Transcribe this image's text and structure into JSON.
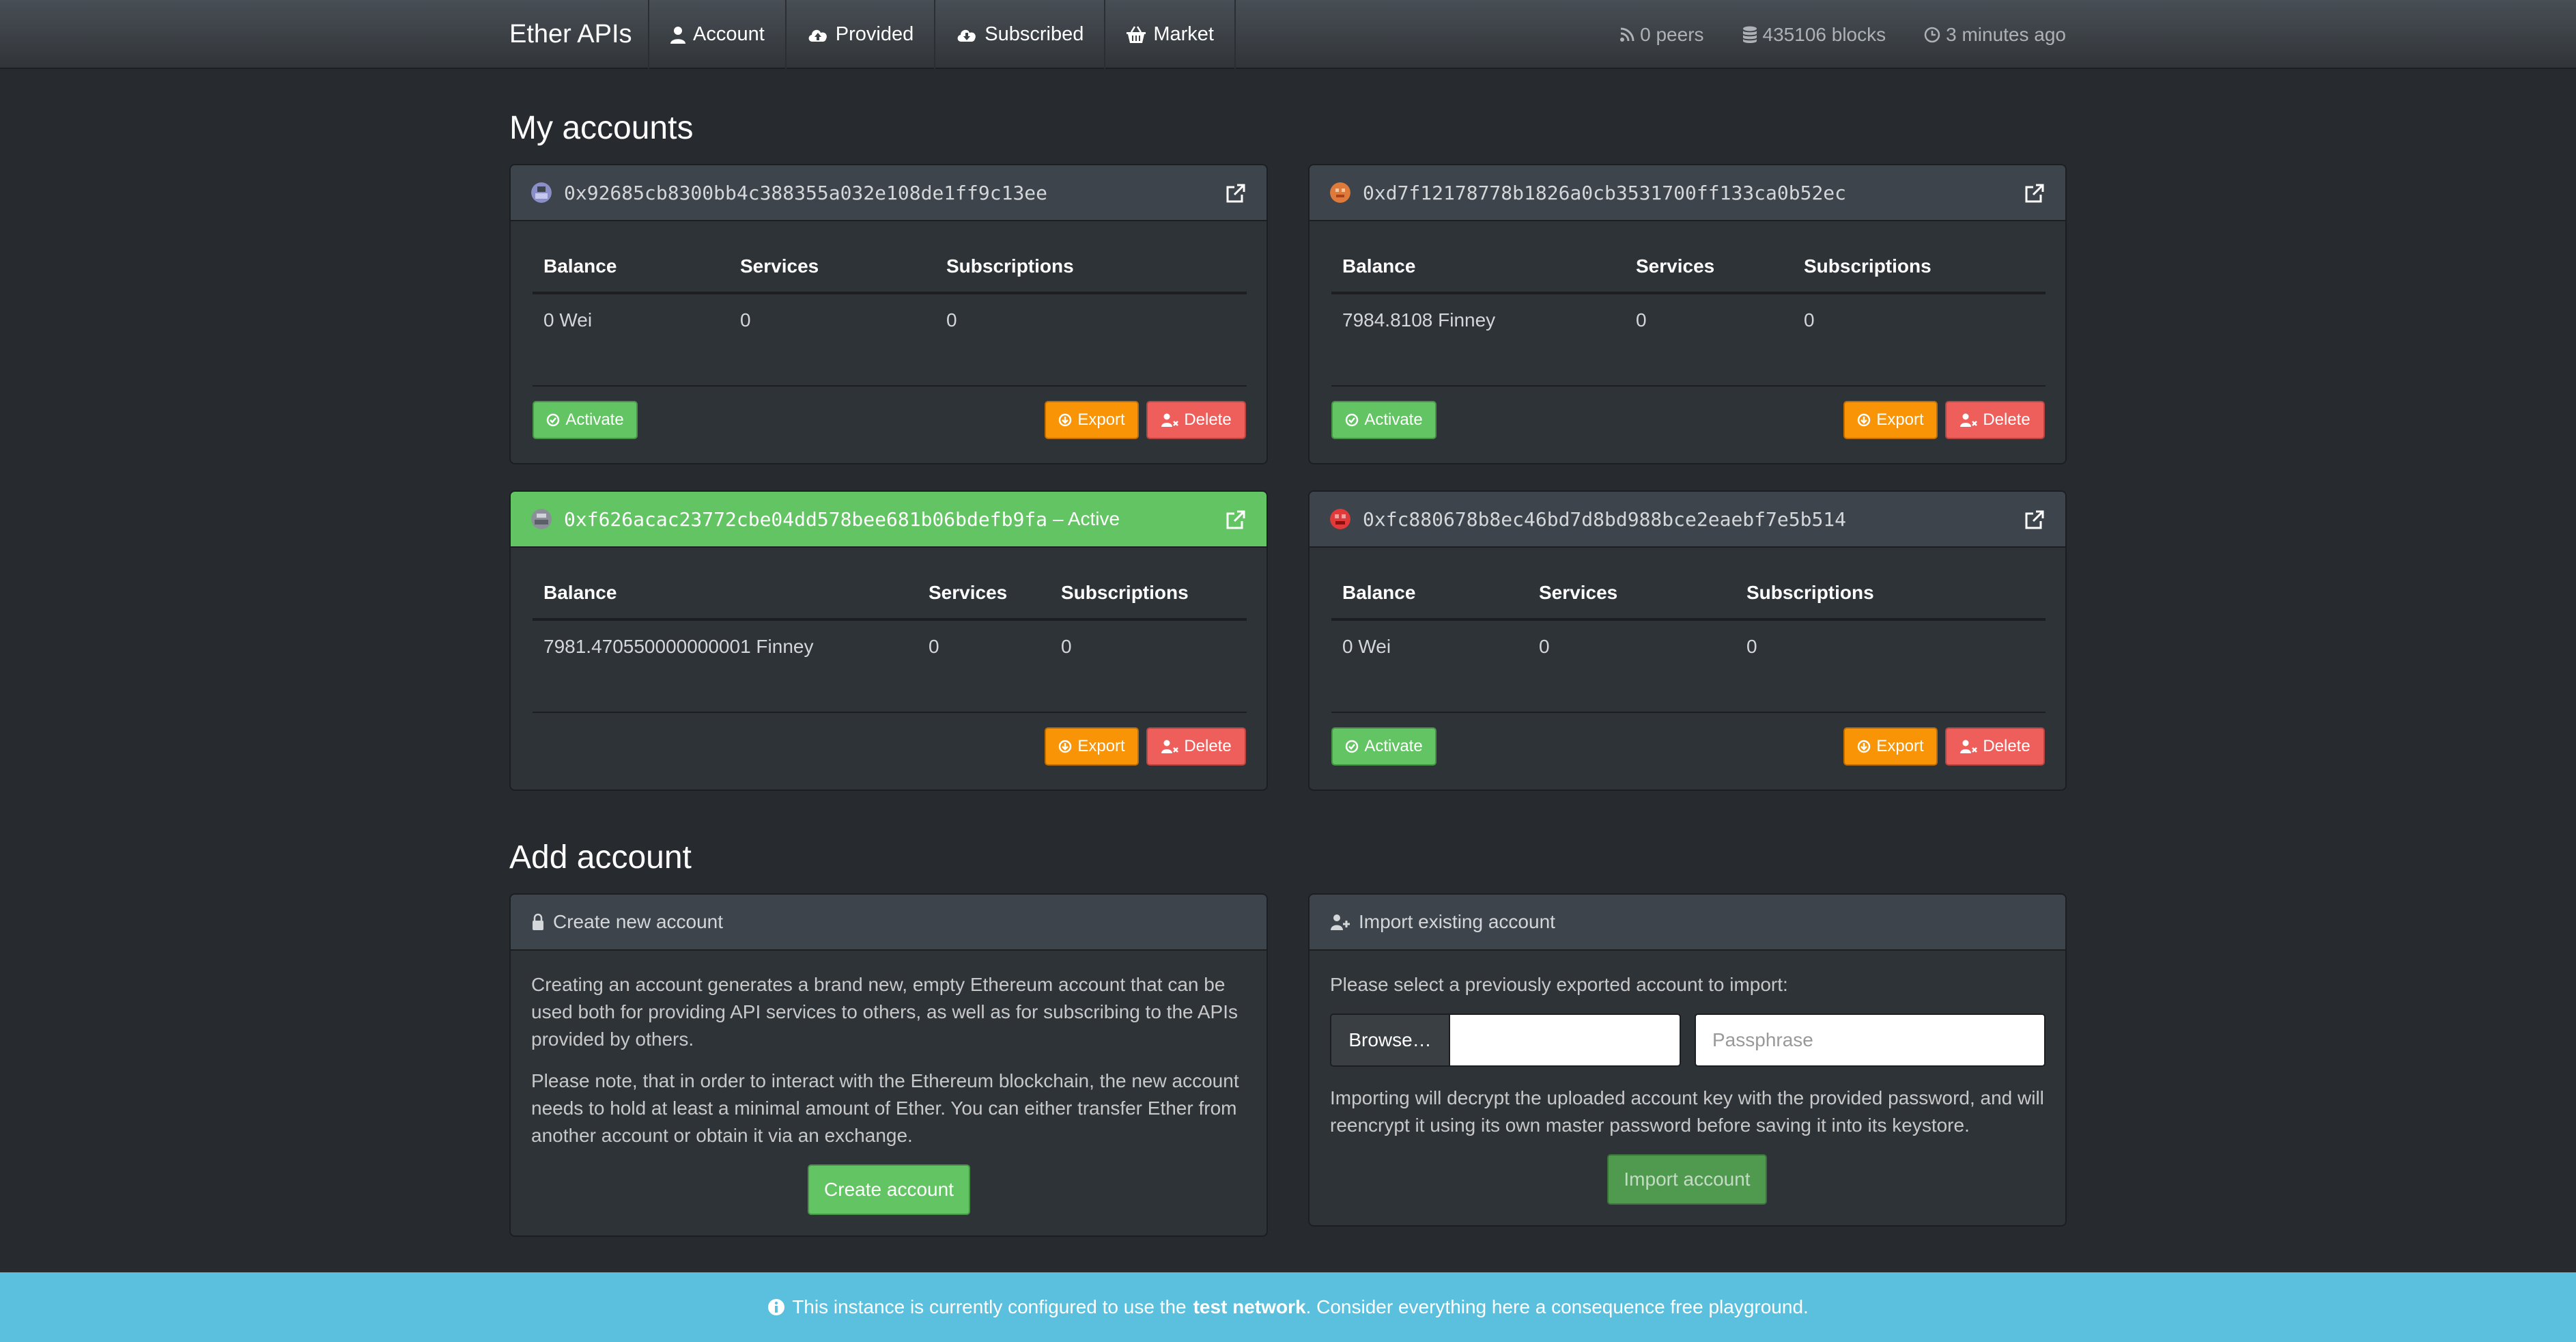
{
  "nav": {
    "brand": "Ether APIs",
    "links": [
      {
        "label": "Account",
        "icon": "user-icon"
      },
      {
        "label": "Provided",
        "icon": "cloud-upload-icon"
      },
      {
        "label": "Subscribed",
        "icon": "cloud-download-icon"
      },
      {
        "label": "Market",
        "icon": "basket-icon"
      }
    ],
    "stats": {
      "peers": "0 peers",
      "blocks": "435106 blocks",
      "time": "3 minutes ago"
    }
  },
  "accounts_title": "My accounts",
  "columns": {
    "balance": "Balance",
    "services": "Services",
    "subscriptions": "Subscriptions"
  },
  "accounts": [
    {
      "address": "0x92685cb8300bb4c388355a032e108de1ff9c13ee",
      "active_tag": "",
      "balance": "0 Wei",
      "services": "0",
      "subscriptions": "0",
      "avatar_color": "#8a8fc8"
    },
    {
      "address": "0xd7f12178778b1826a0cb3531700ff133ca0b52ec",
      "active_tag": "",
      "balance": "7984.8108 Finney",
      "services": "0",
      "subscriptions": "0",
      "avatar_color": "#e07a3a"
    },
    {
      "address": "0xf626acac23772cbe04dd578bee681b06bdefb9fa",
      "active_tag": "– Active",
      "balance": "7981.470550000000001 Finney",
      "services": "0",
      "subscriptions": "0",
      "avatar_color": "#8a8f98"
    },
    {
      "address": "0xfc880678b8ec46bd7d8bd988bce2eaebf7e5b514",
      "active_tag": "",
      "balance": "0 Wei",
      "services": "0",
      "subscriptions": "0",
      "avatar_color": "#e03a3a"
    }
  ],
  "buttons": {
    "activate": "Activate",
    "export": "Export",
    "delete": "Delete"
  },
  "add_title": "Add account",
  "create": {
    "title": "Create new account",
    "para1": "Creating an account generates a brand new, empty Ethereum account that can be used both for providing API services to others, as well as for subscribing to the APIs provided by others.",
    "para2": "Please note, that in order to interact with the Ethereum blockchain, the new account needs to hold at least a minimal amount of Ether. You can either transfer Ether from another account or obtain it via an exchange.",
    "button": "Create account"
  },
  "import": {
    "title": "Import existing account",
    "prompt": "Please select a previously exported account to import:",
    "browse": "Browse…",
    "file_value": "",
    "passphrase_placeholder": "Passphrase",
    "note": "Importing will decrypt the uploaded account key with the provided password, and will reencrypt it using its own master password before saving it into its keystore.",
    "button": "Import account"
  },
  "footer": {
    "pre": "This instance is currently configured to use the",
    "bold": "test network",
    "post": ". Consider everything here a consequence free playground."
  },
  "colors": {
    "bg": "#272b30",
    "panel": "#2e3338",
    "success": "#62c462",
    "warning": "#f89406",
    "danger": "#ee5f5b",
    "info": "#5bc0de"
  }
}
